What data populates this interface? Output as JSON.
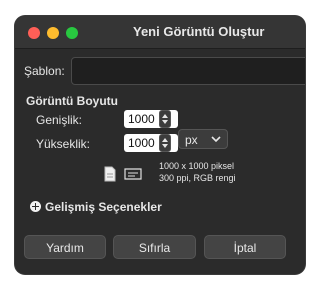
{
  "window": {
    "title": "Yeni Görüntü Oluştur"
  },
  "template": {
    "label": "Şablon:",
    "value": ""
  },
  "image_size": {
    "heading": "Görüntü Boyutu",
    "width_label": "Genişlik:",
    "width_value": "1000",
    "height_label": "Yükseklik:",
    "height_value": "1000",
    "unit": "px",
    "info_line1": "1000 x 1000 piksel",
    "info_line2": "300 ppi, RGB rengi"
  },
  "advanced": {
    "label": "Gelişmiş Seçenekler"
  },
  "buttons": {
    "help": "Yardım",
    "reset": "Sıfırla",
    "cancel": "İptal"
  },
  "colors": {
    "window_bg": "#2b2b2b",
    "titlebar_bg": "#353535",
    "close": "#ff5f57",
    "minimize": "#febc2e",
    "maximize": "#28c840"
  },
  "icons": {
    "portrait": "portrait-orientation-icon",
    "landscape": "landscape-orientation-icon",
    "expander": "plus-circle-icon",
    "unit_dropdown": "chevron-down-icon"
  }
}
